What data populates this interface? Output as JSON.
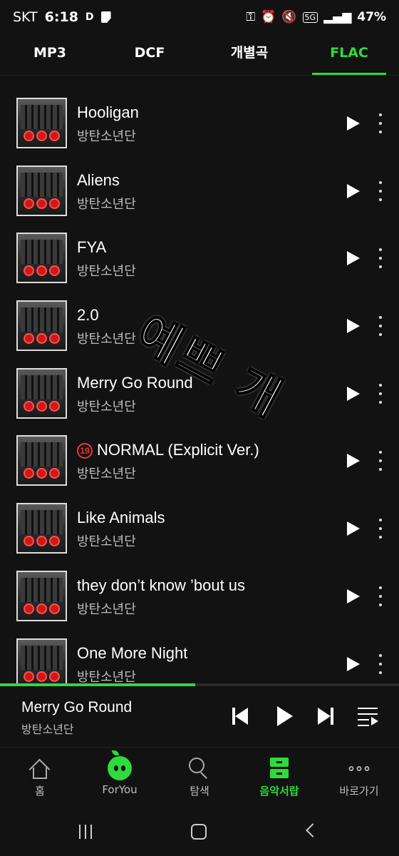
{
  "status": {
    "carrier": "SKT",
    "time": "6:18",
    "d_badge": "D",
    "battery": "47%",
    "network": "5G"
  },
  "tabs": [
    {
      "label": "MP3",
      "active": false
    },
    {
      "label": "DCF",
      "active": false
    },
    {
      "label": "개별곡",
      "active": false
    },
    {
      "label": "FLAC",
      "active": true
    }
  ],
  "songs": [
    {
      "title": "Hooligan",
      "artist": "방탄소년단"
    },
    {
      "title": "Aliens",
      "artist": "방탄소년단"
    },
    {
      "title": "FYA",
      "artist": "방탄소년단"
    },
    {
      "title": "2.0",
      "artist": "방탄소년단"
    },
    {
      "title": "Merry Go Round",
      "artist": "방탄소년단"
    },
    {
      "title": "NORMAL (Explicit Ver.)",
      "artist": "방탄소년단",
      "age_badge": "19"
    },
    {
      "title": "Like Animals",
      "artist": "방탄소년단"
    },
    {
      "title": "they don’t know ’bout us",
      "artist": "방탄소년단"
    },
    {
      "title": "One More Night",
      "artist": "방탄소년단"
    }
  ],
  "overlay_text": "예쁘 개",
  "player": {
    "title": "Merry Go Round",
    "artist": "방탄소년단",
    "progress": 0.49
  },
  "nav": [
    {
      "label": "홈",
      "icon": "home-icon",
      "active": false
    },
    {
      "label": "ForYou",
      "icon": "foryou-icon",
      "active": false
    },
    {
      "label": "탐색",
      "icon": "search-icon",
      "active": false
    },
    {
      "label": "음악서랍",
      "icon": "library-icon",
      "active": true
    },
    {
      "label": "바로가기",
      "icon": "more-dots-icon",
      "active": false
    }
  ],
  "colors": {
    "accent": "#2ddb3a",
    "background": "#121212",
    "age_badge": "#e53935"
  }
}
